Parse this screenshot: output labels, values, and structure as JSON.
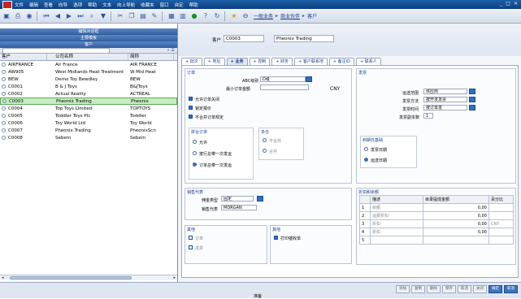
{
  "menubar": {
    "items": [
      "文件",
      "编辑",
      "查看",
      "向导",
      "选项",
      "帮助",
      "文本",
      "向上导航",
      "收藏夹",
      "窗口",
      "自定",
      "帮助"
    ],
    "window_controls": [
      "_",
      "□",
      "×"
    ]
  },
  "toolbar": {
    "icons": [
      "save-icon",
      "print-icon",
      "preview-icon",
      "first-record-icon",
      "prev-record-icon",
      "next-record-icon",
      "last-record-icon",
      "find-icon",
      "filter-icon",
      "cut-icon",
      "copy-icon",
      "paste-icon",
      "edit-icon",
      "copy-record-icon",
      "grid-icon",
      "status-icon",
      "help-icon",
      "refresh-icon"
    ],
    "breadcrumb": [
      "一般业务",
      "商业伙伴",
      "客户"
    ]
  },
  "left": {
    "buttons": [
      "编辑对话框",
      "主要模板",
      "客户"
    ],
    "headers": [
      "客户",
      "公司名称",
      "简称"
    ],
    "rows": [
      [
        "AIRFRANCE",
        "Air France",
        "AIR FRANCE"
      ],
      [
        "AW905",
        "West Midlands Heat Treatment",
        "W Mid Heat"
      ],
      [
        "BEW",
        "Demo Toy Bewdley",
        "BEW"
      ],
      [
        "C0001",
        "B & J Toys",
        "B&JToys"
      ],
      [
        "C0002",
        "Actual Reality",
        "ACTREAL"
      ],
      [
        "C0003",
        "Pheonix Trading",
        "Pheonix"
      ],
      [
        "C0004",
        "Top Toys Limited",
        "TOPTOYS"
      ],
      [
        "C0005",
        "Toddler Toys Plc",
        "Toddler"
      ],
      [
        "C0006",
        "Toy World Ltd",
        "Toy World"
      ],
      [
        "C0007",
        "Pheonix Trading",
        "PheonixScn"
      ],
      [
        "C0008",
        "Sebem",
        "Sebem"
      ]
    ],
    "selected_index": 5
  },
  "header": {
    "label": "客户",
    "code": "C0003",
    "name": "Pheonix Trading"
  },
  "tabs": [
    "+ 批次",
    "+ 地址",
    "+ 业务",
    "+ 控制",
    "+ 财务",
    "+ 客户联系地",
    "+ 备注ID",
    "+ 联系人"
  ],
  "active_tab": 2,
  "orders": {
    "title": "订单",
    "abc_label": "ABC级别",
    "abc_value": "D级",
    "min_amount_label": "最小订单金额",
    "currency": "CNY",
    "checks": [
      "允许订单关闭",
      "锁定报价",
      "不合并订单规定"
    ],
    "checks_state": [
      true,
      true,
      true
    ]
  },
  "consolidation": {
    "title": "拼合订单",
    "options": [
      "允许",
      "按行总带一次发运",
      "订单总带一次发运"
    ],
    "selected": 2
  },
  "partial": {
    "title": "多仓",
    "options": [
      "不合并",
      "合并"
    ]
  },
  "delivery": {
    "title": "发票",
    "fields": [
      {
        "label": "运送范围",
        "value": "供应商"
      },
      {
        "label": "发票方法",
        "value": "按开发发票"
      },
      {
        "label": "发票时间",
        "value": "按订单发"
      }
    ],
    "copies_label": "发票副本数",
    "copies_value": "1"
  },
  "posting": {
    "title": "到期日基础",
    "options": [
      "发票日期",
      "运送日期"
    ],
    "selected": 1
  },
  "sales": {
    "title": "销售代表",
    "type_label": "佣金类型",
    "type_value": "固定",
    "rep_label": "销售代表",
    "rep_value": "MORGAN"
  },
  "misc": {
    "title": "其他",
    "checks": [
      "订单",
      "发票"
    ]
  },
  "reminders": {
    "title": "其他",
    "check": "打印催收单"
  },
  "discounts": {
    "title": "折扣和余额",
    "headers": [
      "描述",
      "目录提成金额",
      "百分比"
    ],
    "rows": [
      {
        "n": "1",
        "desc": "余额",
        "amount": "0,00",
        "pct": ""
      },
      {
        "n": "2",
        "desc": "运费折扣",
        "amount": "0,00",
        "pct": ""
      },
      {
        "n": "3",
        "desc": "折扣",
        "amount": "0,00",
        "pct": "CNY"
      },
      {
        "n": "4",
        "desc": "折扣",
        "amount": "0,00",
        "pct": ""
      },
      {
        "n": "5",
        "desc": "",
        "amount": "",
        "pct": ""
      }
    ]
  },
  "status": {
    "text": "准备",
    "buttons": [
      "添加",
      "复制",
      "删除",
      "保存",
      "取消",
      "关闭",
      "确定",
      "取消"
    ]
  }
}
